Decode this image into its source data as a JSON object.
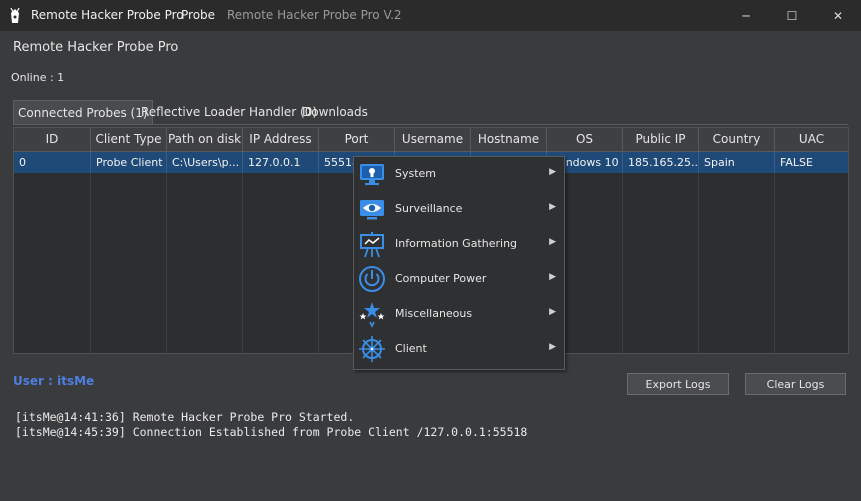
{
  "titlebar": {
    "app_title": "Remote Hacker Probe Pro",
    "menu_probe": "Probe",
    "version_title": "Remote Hacker Probe Pro V.2",
    "minimize_glyph": "─",
    "maximize_glyph": "☐",
    "close_glyph": "✕"
  },
  "header": {
    "heading": "Remote Hacker Probe Pro",
    "online": "Online : 1"
  },
  "tabs": [
    {
      "label": "Connected Probes (1)",
      "active": true
    },
    {
      "label": "Reflective Loader Handler (0)",
      "active": false
    },
    {
      "label": "Downloads",
      "active": false
    }
  ],
  "table": {
    "columns": [
      "ID",
      "Client Type",
      "Path on disk",
      "IP Address",
      "Port",
      "Username",
      "Hostname",
      "OS",
      "Public IP",
      "Country",
      "UAC"
    ],
    "rows": [
      [
        "0",
        "Probe Client",
        "C:\\Users\\p...",
        "127.0.0.1",
        "55518",
        "",
        "",
        "Windows 10",
        "185.165.25...",
        "Spain",
        "FALSE"
      ]
    ]
  },
  "context_menu": {
    "items": [
      {
        "label": "System",
        "icon": "monitor-icon"
      },
      {
        "label": "Surveillance",
        "icon": "eye-icon"
      },
      {
        "label": "Information Gathering",
        "icon": "easel-icon"
      },
      {
        "label": "Computer Power",
        "icon": "power-icon"
      },
      {
        "label": "Miscellaneous",
        "icon": "stars-icon"
      },
      {
        "label": "Client",
        "icon": "helm-icon"
      }
    ],
    "arrow_glyph": "▶"
  },
  "user": {
    "label": "User : itsMe"
  },
  "buttons": {
    "export": "Export Logs",
    "clear": "Clear Logs"
  },
  "logs": [
    "[itsMe@14:41:36] Remote Hacker Probe Pro Started.",
    "[itsMe@14:45:39] Connection Established from Probe Client /127.0.0.1:55518"
  ],
  "colors": {
    "accent": "#4e7ee0",
    "selection": "#1f4a78",
    "icon_blue": "#3a8ee6"
  }
}
